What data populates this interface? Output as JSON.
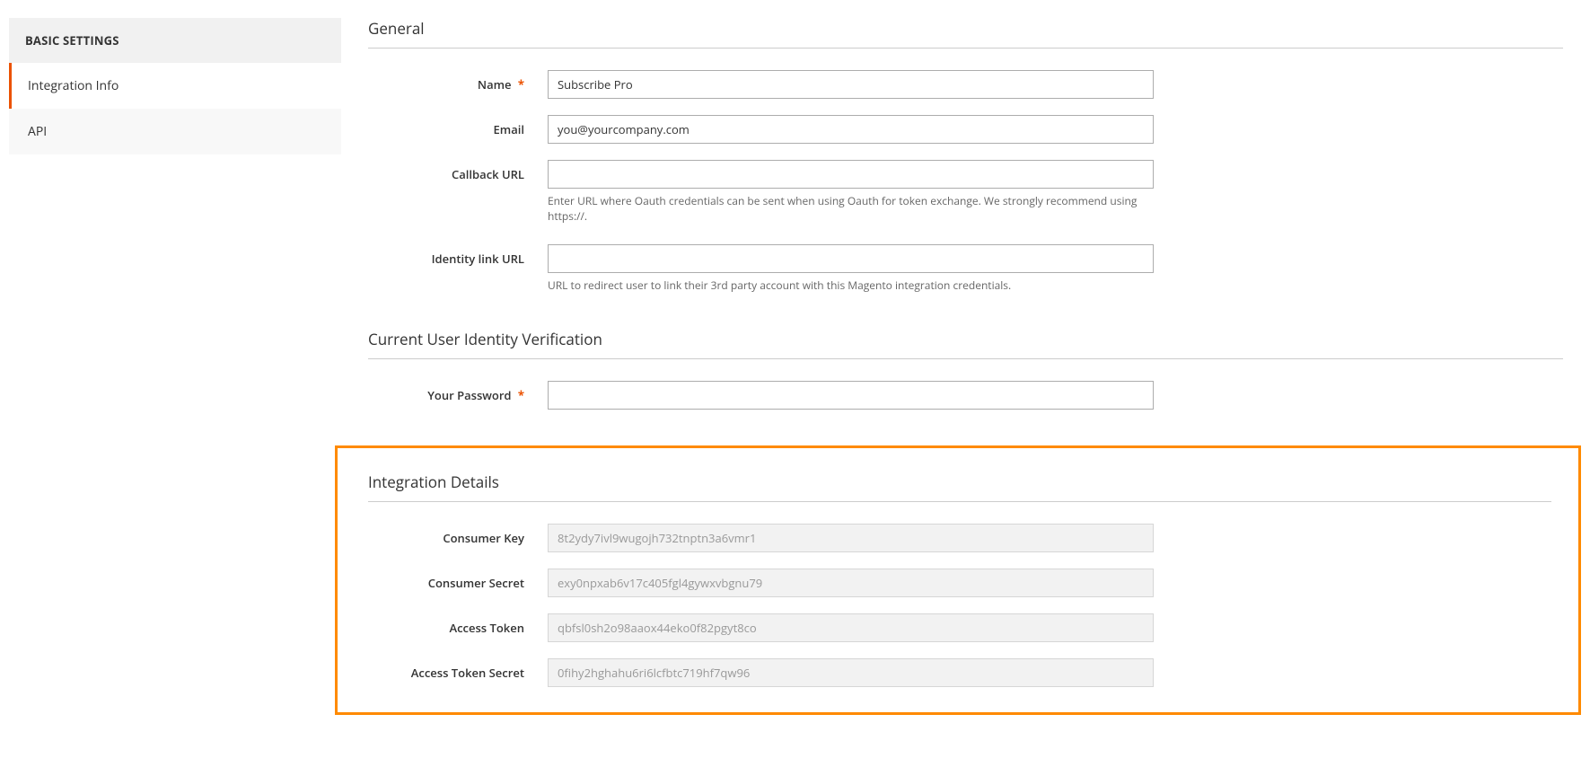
{
  "sidebar": {
    "heading": "BASIC SETTINGS",
    "tabs": [
      {
        "label": "Integration Info",
        "active": true
      },
      {
        "label": "API",
        "active": false
      }
    ]
  },
  "sections": {
    "general": {
      "title": "General",
      "fields": {
        "name": {
          "label": "Name",
          "value": "Subscribe Pro",
          "required": true
        },
        "email": {
          "label": "Email",
          "value": "you@yourcompany.com",
          "required": false
        },
        "callback_url": {
          "label": "Callback URL",
          "value": "",
          "required": false,
          "note": "Enter URL where Oauth credentials can be sent when using Oauth for token exchange. We strongly recommend using https://."
        },
        "identity_link_url": {
          "label": "Identity link URL",
          "value": "",
          "required": false,
          "note": "URL to redirect user to link their 3rd party account with this Magento integration credentials."
        }
      }
    },
    "verification": {
      "title": "Current User Identity Verification",
      "fields": {
        "password": {
          "label": "Your Password",
          "value": "",
          "required": true
        }
      }
    },
    "details": {
      "title": "Integration Details",
      "fields": {
        "consumer_key": {
          "label": "Consumer Key",
          "value": "8t2ydy7ivl9wugojh732tnptn3a6vmr1"
        },
        "consumer_secret": {
          "label": "Consumer Secret",
          "value": "exy0npxab6v17c405fgl4gywxvbgnu79"
        },
        "access_token": {
          "label": "Access Token",
          "value": "qbfsl0sh2o98aaox44eko0f82pgyt8co"
        },
        "access_token_secret": {
          "label": "Access Token Secret",
          "value": "0fihy2hghahu6ri6lcfbtc719hf7qw96"
        }
      }
    }
  }
}
